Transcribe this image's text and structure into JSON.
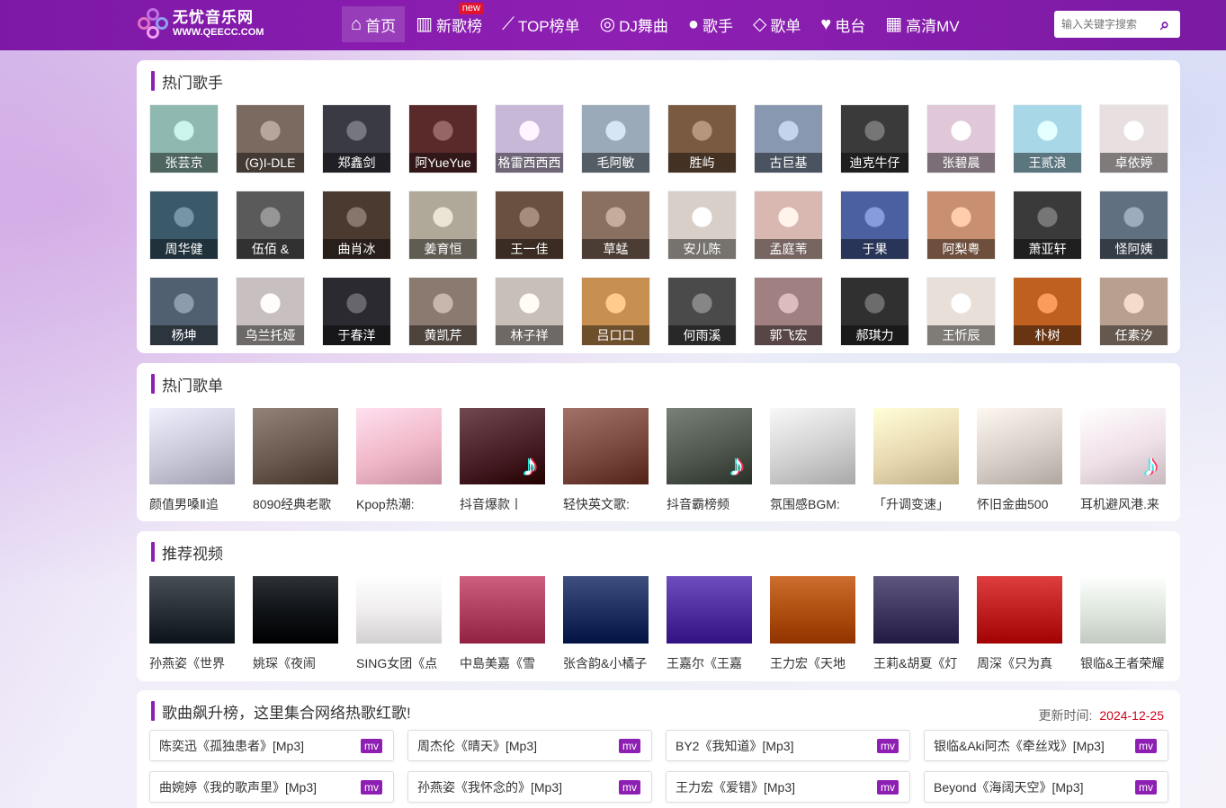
{
  "site": {
    "name_cn": "无忧音乐网",
    "name_en": "WWW.QEECC.COM"
  },
  "nav": [
    {
      "label": "首页",
      "icon": "home-icon",
      "glyph": "⌂",
      "active": true
    },
    {
      "label": "新歌榜",
      "icon": "bar-chart-icon",
      "glyph": "▥",
      "badge": "new"
    },
    {
      "label": "TOP榜单",
      "icon": "trend-line-icon",
      "glyph": "⟋"
    },
    {
      "label": "DJ舞曲",
      "icon": "disc-icon",
      "glyph": "◎"
    },
    {
      "label": "歌手",
      "icon": "user-icon",
      "glyph": "●"
    },
    {
      "label": "歌单",
      "icon": "diamond-icon",
      "glyph": "◇"
    },
    {
      "label": "电台",
      "icon": "heartbeat-icon",
      "glyph": "♥"
    },
    {
      "label": "高清MV",
      "icon": "film-icon",
      "glyph": "▦"
    }
  ],
  "search": {
    "placeholder": "输入关键字搜索"
  },
  "hot_singers": {
    "title": "热门歌手",
    "items": [
      "张芸京",
      "(G)I-DLE",
      "郑鑫剑",
      "阿YueYue",
      "格雷西西西",
      "毛阿敏",
      "胜屿",
      "古巨基",
      "迪克牛仔",
      "张碧晨",
      "王贰浪",
      "卓依婷",
      "周华健",
      "伍佰 &",
      "曲肖冰",
      "姜育恒",
      "王一佳",
      "草蜢",
      "安儿陈",
      "孟庭苇",
      "于果",
      "阿梨粤",
      "萧亚轩",
      "怪阿姨",
      "杨坤",
      "乌兰托娅",
      "于春洋",
      "黄凯芹",
      "林子祥",
      "吕口口",
      "何雨溪",
      "郭飞宏",
      "郝琪力",
      "王忻辰",
      "朴树",
      "任素汐"
    ],
    "colors": [
      "#8fb8b0",
      "#7a6a60",
      "#3a3a44",
      "#5a2a2a",
      "#c8b8d8",
      "#9aaab8",
      "#7a5a40",
      "#8898b0",
      "#3a3a3a",
      "#e0c8d8",
      "#a8d8e8",
      "#e8e0e0",
      "#3a5a6a",
      "#5a5a5a",
      "#4a3a30",
      "#b0a898",
      "#6a5040",
      "#8a7060",
      "#d8d0c8",
      "#d8b8b0",
      "#4a60a0",
      "#c89070",
      "#3a3a3a",
      "#607080",
      "#506070",
      "#c8c0c0",
      "#2a2a30",
      "#8a7a70",
      "#c8c0b8",
      "#c89050",
      "#4a4a4a",
      "#a08080",
      "#303030",
      "#e8e0d8",
      "#c06020",
      "#b8a090"
    ]
  },
  "hot_playlists": {
    "title": "热门歌单",
    "items": [
      "颜值男嗓Ⅱ追",
      "8090经典老歌",
      "Kpop热潮:",
      "抖音爆款丨",
      "轻快英文歌:",
      "抖音霸榜频",
      "氛围感BGM:",
      "「升调变速」",
      "怀旧金曲500",
      "耳机避风港.来"
    ],
    "colors": [
      "#c8c8d8",
      "#6a5a50",
      "#f0b8c8",
      "#4a2028",
      "#7a4a40",
      "#505850",
      "#d0d0d0",
      "#e8d8b0",
      "#d8d0c8",
      "#f0e0e8"
    ],
    "tiktok": [
      false,
      false,
      false,
      true,
      false,
      true,
      false,
      false,
      false,
      true
    ]
  },
  "videos": {
    "title": "推荐视频",
    "items": [
      "孙燕姿《世界",
      "姚琛《夜闹",
      "SING女团《点",
      "中島美嘉《雪",
      "张含韵&小橘子",
      "王嘉尔《王嘉",
      "王力宏《天地",
      "王莉&胡夏《灯",
      "周深《只为真",
      "银临&王者荣耀"
    ],
    "colors": [
      "#2a3038",
      "#101418",
      "#f0eeee",
      "#b04060",
      "#203060",
      "#5030a0",
      "#b05010",
      "#403860",
      "#c02020",
      "#e0e8e0"
    ]
  },
  "chart_songs": {
    "title": "歌曲飙升榜，这里集合网络热歌红歌!",
    "update_label": "更新时间:",
    "update_date": "2024-12-25",
    "mv_label": "mv",
    "items": [
      "陈奕迅《孤独患者》[Mp3]",
      "周杰伦《晴天》[Mp3]",
      "BY2《我知道》[Mp3]",
      "银临&Aki阿杰《牵丝戏》[Mp3]",
      "曲婉婷《我的歌声里》[Mp3]",
      "孙燕姿《我怀念的》[Mp3]",
      "王力宏《爱错》[Mp3]",
      "Beyond《海阔天空》[Mp3]"
    ]
  }
}
